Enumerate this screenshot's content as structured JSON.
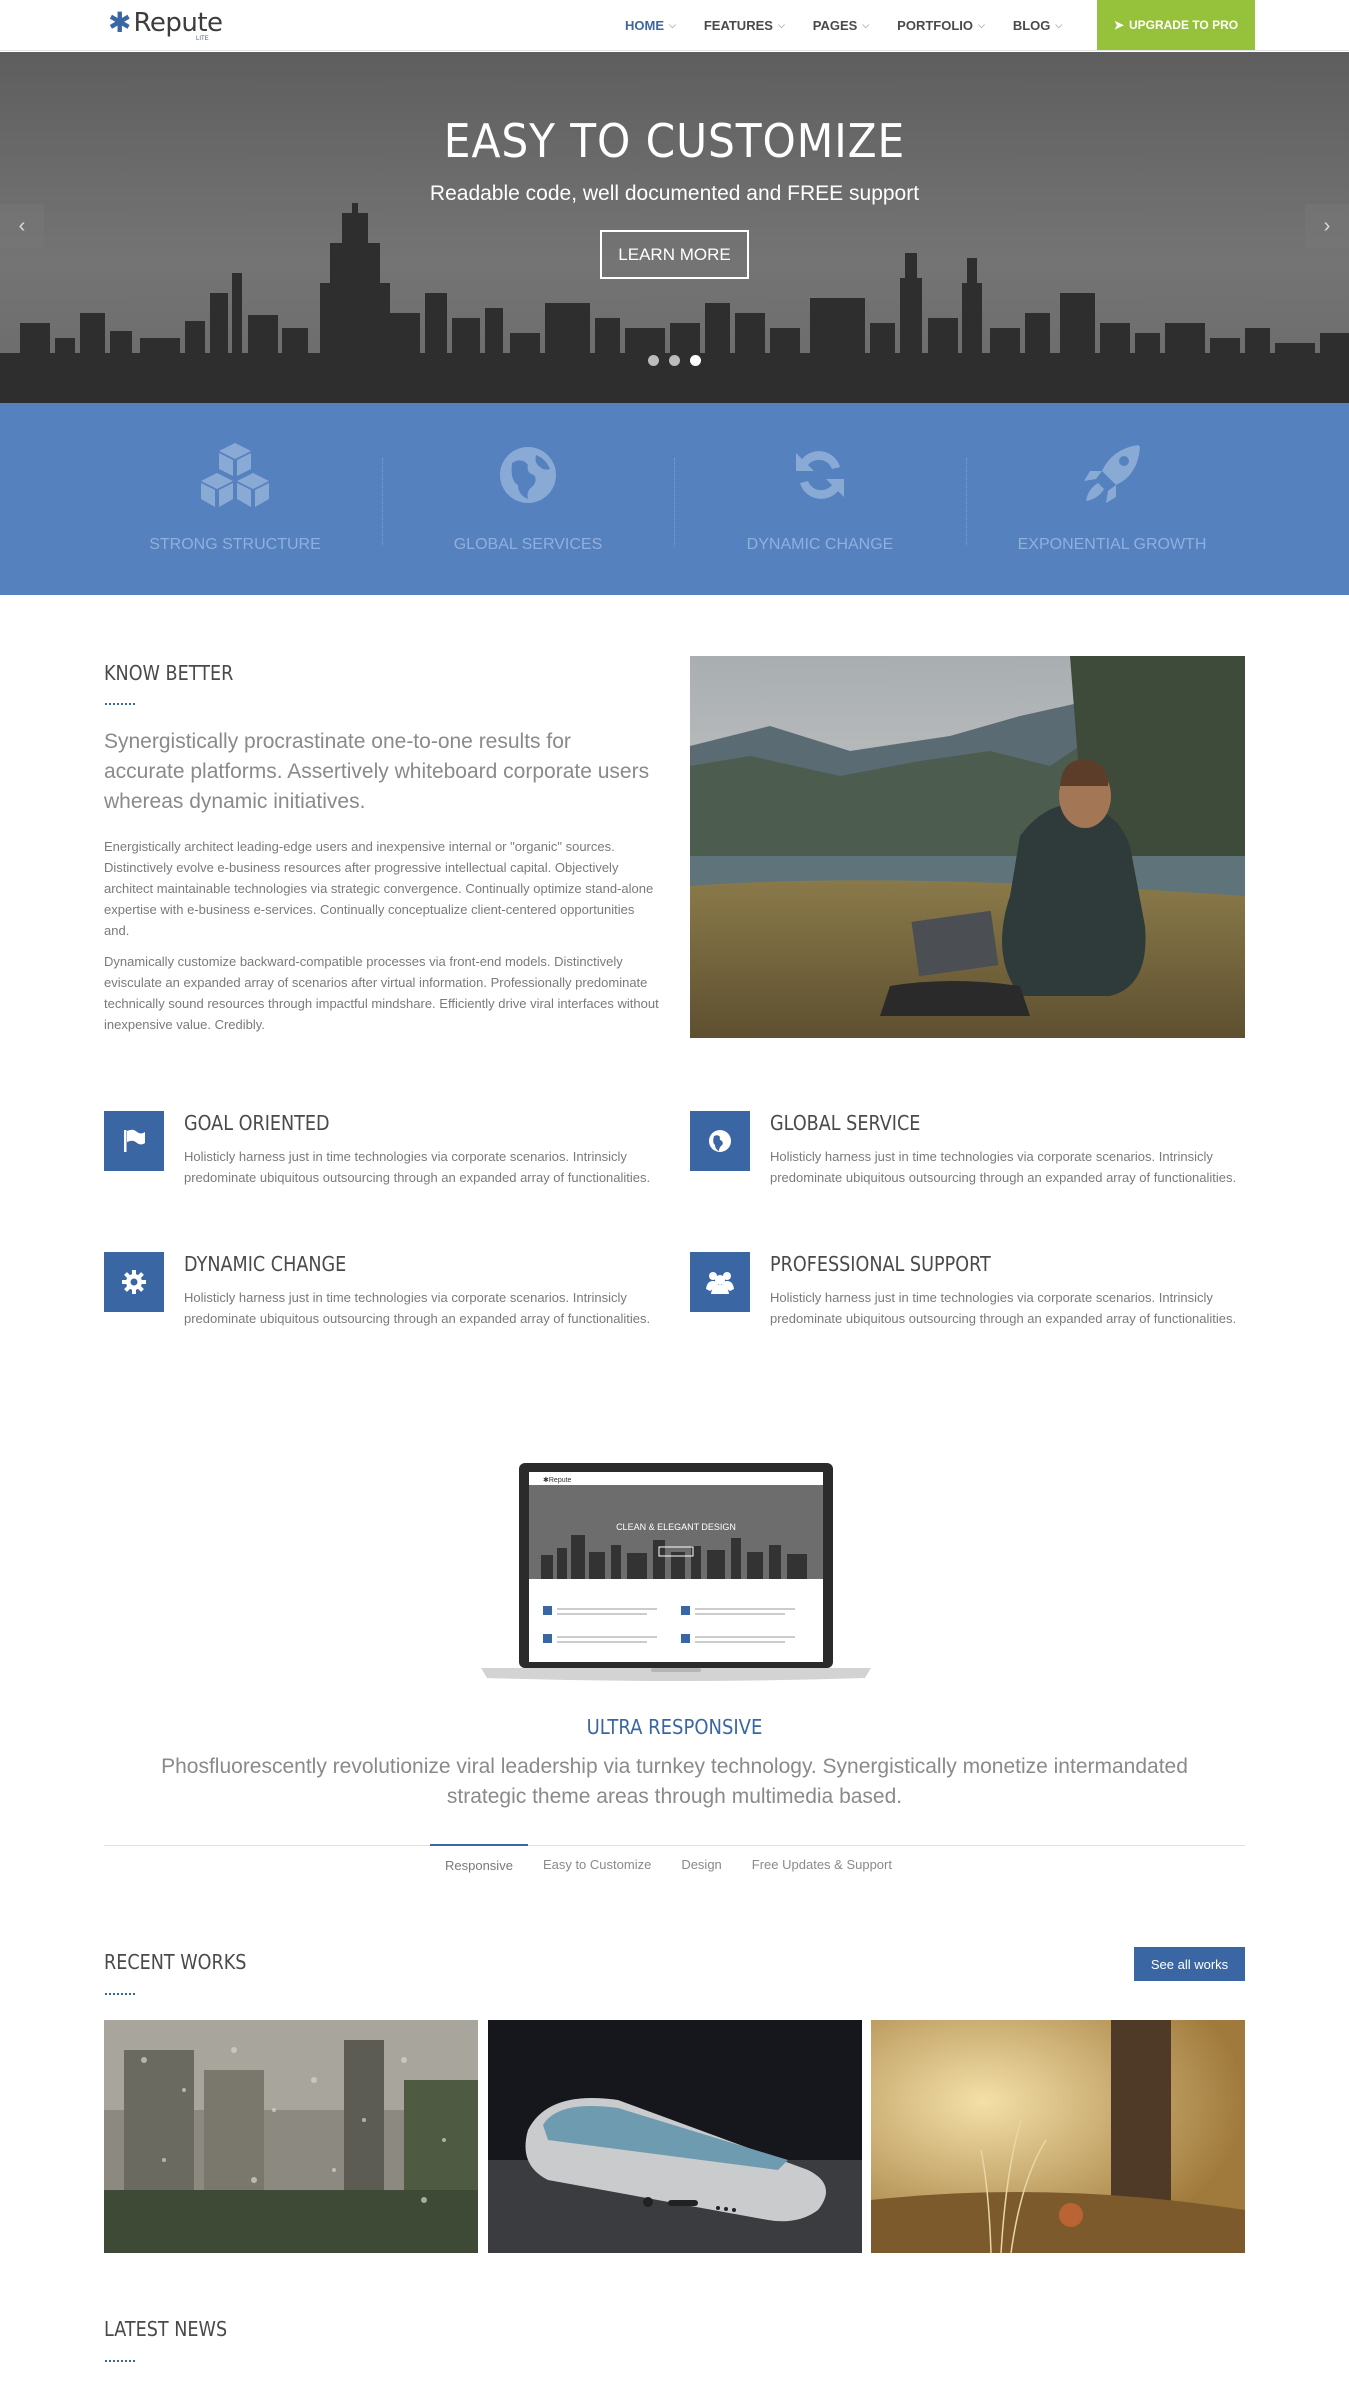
{
  "header": {
    "logo_text": "Repute",
    "logo_sub": "LITE",
    "nav": [
      {
        "label": "HOME",
        "active": true
      },
      {
        "label": "FEATURES",
        "active": false
      },
      {
        "label": "PAGES",
        "active": false
      },
      {
        "label": "PORTFOLIO",
        "active": false
      },
      {
        "label": "BLOG",
        "active": false
      }
    ],
    "cta_label": "UPGRADE TO PRO",
    "cta_icon": "rocket-icon",
    "cta_color": "#96c13a"
  },
  "hero": {
    "title": "EASY TO CUSTOMIZE",
    "subtitle": "Readable code, well documented and FREE support",
    "button_label": "LEARN MORE",
    "prev_icon": "chevron-left-icon",
    "next_icon": "chevron-right-icon",
    "slides": 3,
    "active_slide": 3
  },
  "strip": {
    "color": "#5681bf",
    "items": [
      {
        "label": "STRONG STRUCTURE",
        "icon": "cubes-icon"
      },
      {
        "label": "GLOBAL SERVICES",
        "icon": "globe-icon"
      },
      {
        "label": "DYNAMIC CHANGE",
        "icon": "refresh-icon"
      },
      {
        "label": "EXPONENTIAL GROWTH",
        "icon": "rocket-icon"
      }
    ]
  },
  "know_better": {
    "heading": "KNOW BETTER",
    "lead": "Synergistically procrastinate one-to-one results for accurate platforms. Assertively whiteboard corporate users whereas dynamic initiatives.",
    "p1": "Energistically architect leading-edge users and inexpensive internal or \"organic\" sources. Distinctively evolve e-business resources after progressive intellectual capital. Objectively architect maintainable technologies via strategic convergence. Continually optimize stand-alone expertise with e-business e-services. Continually conceptualize client-centered opportunities and.",
    "p2": "Dynamically customize backward-compatible processes via front-end models. Distinctively evisculate an expanded array of scenarios after virtual information. Professionally predominate technically sound resources through impactful mindshare. Efficiently drive viral interfaces without inexpensive value. Credibly."
  },
  "services": [
    {
      "title": "GOAL ORIENTED",
      "icon": "flag-icon",
      "desc": "Holisticly harness just in time technologies via corporate scenarios. Intrinsicly predominate ubiquitous outsourcing through an expanded array of functionalities."
    },
    {
      "title": "GLOBAL SERVICE",
      "icon": "globe-icon",
      "desc": "Holisticly harness just in time technologies via corporate scenarios. Intrinsicly predominate ubiquitous outsourcing through an expanded array of functionalities."
    },
    {
      "title": "DYNAMIC CHANGE",
      "icon": "gear-icon",
      "desc": "Holisticly harness just in time technologies via corporate scenarios. Intrinsicly predominate ubiquitous outsourcing through an expanded array of functionalities."
    },
    {
      "title": "PROFESSIONAL SUPPORT",
      "icon": "users-icon",
      "desc": "Holisticly harness just in time technologies via corporate scenarios. Intrinsicly predominate ubiquitous outsourcing through an expanded array of functionalities."
    }
  ],
  "responsive": {
    "title": "ULTRA RESPONSIVE",
    "subtitle": "Phosfluorescently revolutionize viral leadership via turnkey technology. Synergistically monetize intermandated strategic theme areas through multimedia based.",
    "laptop_screen_title": "CLEAN & ELEGANT DESIGN",
    "tabs": [
      "Responsive",
      "Easy to Customize",
      "Design",
      "Free Updates & Support"
    ],
    "active_tab": 0
  },
  "recent_works": {
    "heading": "RECENT WORKS",
    "button_label": "See all works"
  },
  "latest_news": {
    "heading": "LATEST NEWS"
  },
  "accent": "#3a67a3"
}
